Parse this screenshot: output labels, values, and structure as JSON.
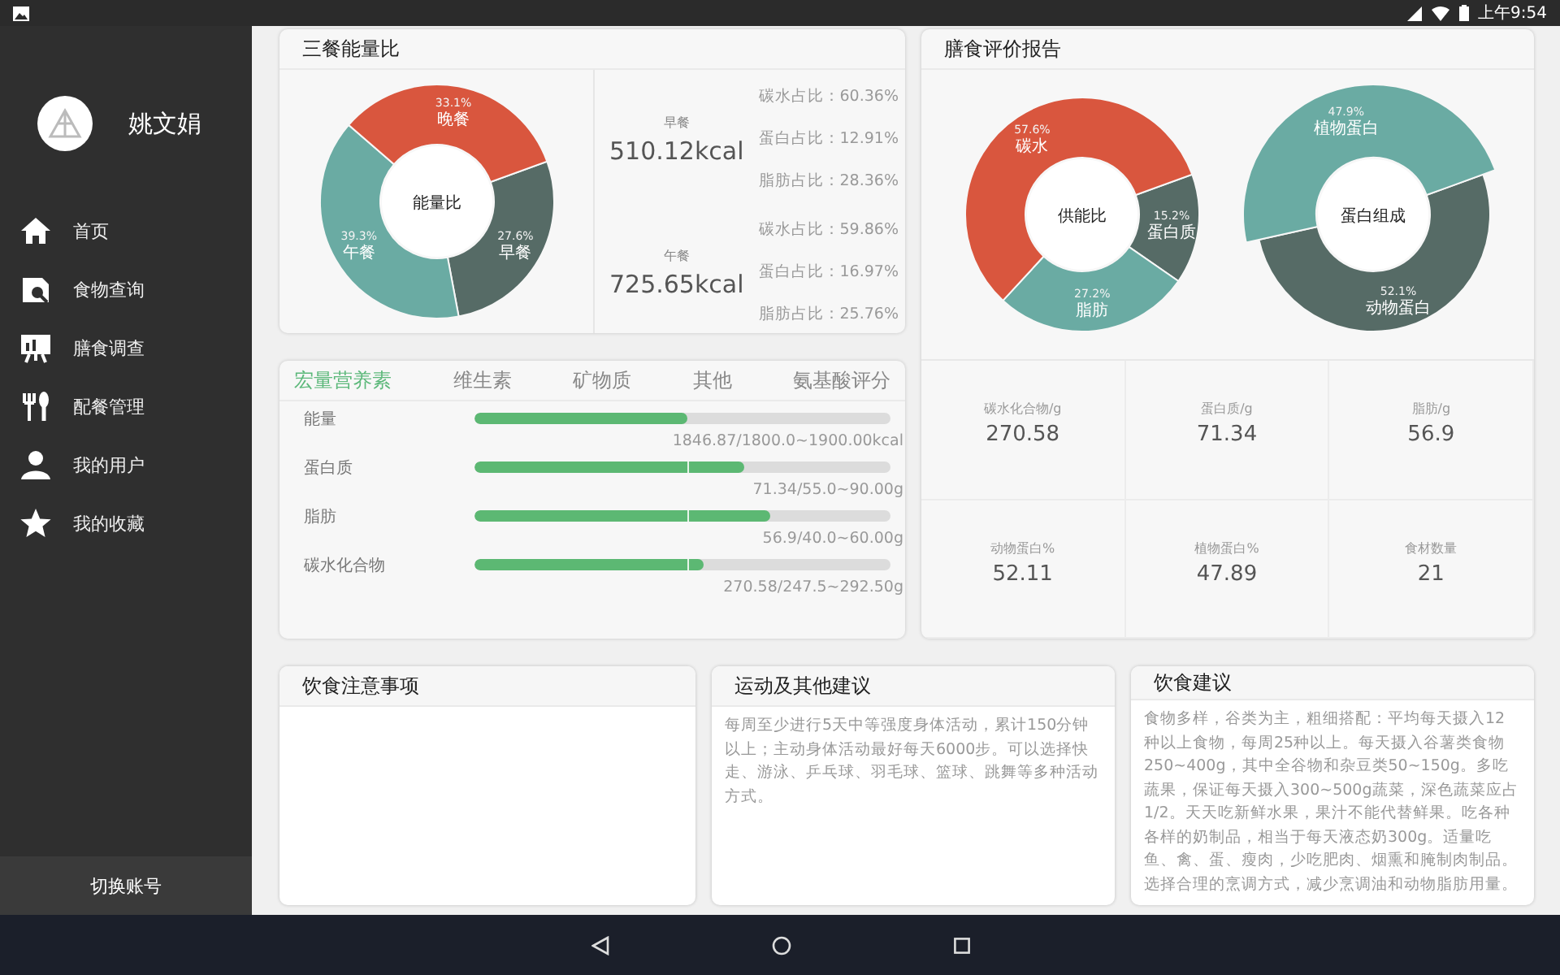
{
  "status_bar": {
    "time": "上午9:54"
  },
  "sidebar": {
    "user_name": "姚文娟",
    "items": [
      {
        "label": "首页"
      },
      {
        "label": "食物查询"
      },
      {
        "label": "膳食调查"
      },
      {
        "label": "配餐管理"
      },
      {
        "label": "我的用户"
      },
      {
        "label": "我的收藏"
      }
    ],
    "switch_account": "切换账号"
  },
  "meal_energy": {
    "title": "三餐能量比",
    "center_label": "能量比",
    "chart_data": {
      "type": "donut",
      "categories": [
        "早餐",
        "午餐",
        "晚餐"
      ],
      "values": [
        27.6,
        39.3,
        33.1
      ],
      "value_labels": [
        "27.6%",
        "39.3%",
        "33.1%"
      ],
      "colors": [
        "#566b66",
        "#6aaba3",
        "#d9563e"
      ]
    },
    "slices": [
      {
        "selected": false
      },
      {
        "selected": false
      },
      {
        "selected": false
      }
    ],
    "meals": [
      {
        "name": "早餐",
        "energy": "510.12kcal",
        "ratios": [
          "碳水占比：60.36%",
          "蛋白占比：12.91%",
          "脂肪占比：28.36%"
        ]
      },
      {
        "name": "午餐",
        "energy": "725.65kcal",
        "ratios": [
          "碳水占比：59.86%",
          "蛋白占比：16.97%",
          "脂肪占比：25.76%"
        ]
      }
    ]
  },
  "nutrients": {
    "tabs": [
      {
        "label": "宏量营养素",
        "selected": true
      },
      {
        "label": "维生素",
        "selected": false
      },
      {
        "label": "矿物质",
        "selected": false
      },
      {
        "label": "其他",
        "selected": false
      },
      {
        "label": "氨基酸评分",
        "selected": false
      }
    ],
    "rows": [
      {
        "name": "能量",
        "level": 0.51,
        "reading": "1846.87/1800.0~1900.00kcal"
      },
      {
        "name": "蛋白质",
        "level": 0.65,
        "reading": "71.34/55.0~90.00g"
      },
      {
        "name": "脂肪",
        "level": 0.71,
        "reading": "56.9/40.0~60.00g"
      },
      {
        "name": "碳水化合物",
        "level": 0.55,
        "reading": "270.58/247.5~292.50g"
      }
    ]
  },
  "diet_report": {
    "title": "膳食评价报告",
    "charts": [
      {
        "center_label": "供能比",
        "chart_data": {
          "type": "donut",
          "categories": [
            "蛋白质",
            "脂肪",
            "碳水"
          ],
          "values": [
            15.2,
            27.2,
            57.6
          ],
          "value_labels": [
            "15.2%",
            "27.2%",
            "57.6%"
          ],
          "colors": [
            "#566b66",
            "#6aaba3",
            "#d9563e"
          ]
        },
        "slices": [
          {
            "selected": false
          },
          {
            "selected": false
          },
          {
            "selected": false
          }
        ]
      },
      {
        "center_label": "蛋白组成",
        "chart_data": {
          "type": "donut",
          "categories": [
            "动物蛋白",
            "植物蛋白"
          ],
          "values": [
            52.1,
            47.9
          ],
          "value_labels": [
            "52.1%",
            "47.9%"
          ],
          "colors": [
            "#566b66",
            "#6aaba3"
          ]
        },
        "slices": [
          {
            "selected": false
          },
          {
            "selected": true
          }
        ]
      }
    ],
    "stats": [
      {
        "label": "碳水化合物/g",
        "value": "270.58"
      },
      {
        "label": "蛋白质/g",
        "value": "71.34"
      },
      {
        "label": "脂肪/g",
        "value": "56.9"
      },
      {
        "label": "动物蛋白%",
        "value": "52.11"
      },
      {
        "label": "植物蛋白%",
        "value": "47.89"
      },
      {
        "label": "食材数量",
        "value": "21"
      }
    ]
  },
  "advice_cards": [
    {
      "title": "饮食注意事项"
    },
    {
      "title": "运动及其他建议",
      "text": "每周至少进行5天中等强度身体活动，累计150分钟以上；主动身体活动最好每天6000步。可以选择快走、游泳、乒乓球、羽毛球、篮球、跳舞等多种活动方式。"
    },
    {
      "title": "饮食建议",
      "text": "食物多样，谷类为主，粗细搭配：平均每天摄入12种以上食物，每周25种以上。每天摄入谷薯类食物250~400g，其中全谷物和杂豆类50~150g。多吃蔬果，保证每天摄入300~500g蔬菜，深色蔬菜应占1/2。天天吃新鲜水果，果汁不能代替鲜果。吃各种各样的奶制品，相当于每天液态奶300g。适量吃鱼、禽、蛋、瘦肉，少吃肥肉、烟熏和腌制肉制品。选择合理的烹调方式，减少烹调油和动物脂肪用量。"
    }
  ]
}
